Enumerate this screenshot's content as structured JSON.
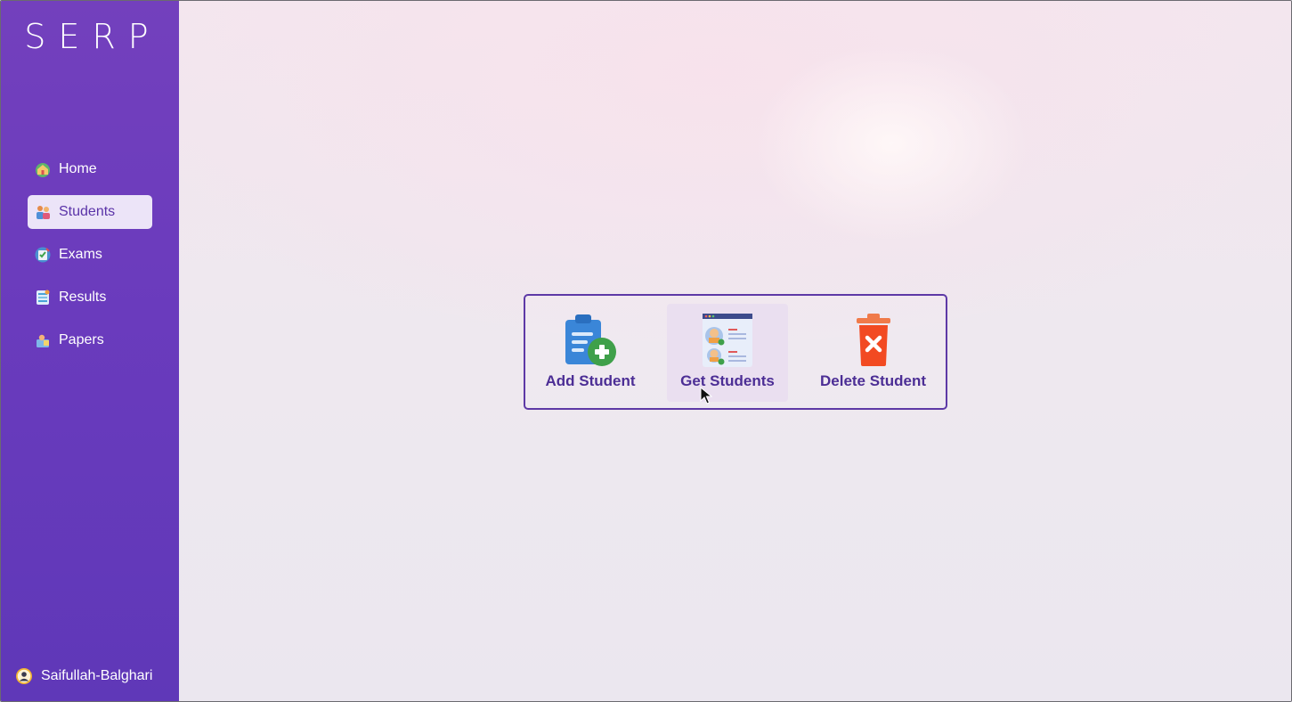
{
  "app": {
    "brand": "SERP"
  },
  "sidebar": {
    "items": [
      {
        "label": "Home",
        "icon": "home-icon",
        "active": false
      },
      {
        "label": "Students",
        "icon": "students-icon",
        "active": true
      },
      {
        "label": "Exams",
        "icon": "exams-icon",
        "active": false
      },
      {
        "label": "Results",
        "icon": "results-icon",
        "active": false
      },
      {
        "label": "Papers",
        "icon": "papers-icon",
        "active": false
      }
    ],
    "user": {
      "name": "Saifullah-Balghari",
      "icon": "user-avatar-icon"
    }
  },
  "main": {
    "actions": [
      {
        "label": "Add Student",
        "icon": "add-clipboard-icon"
      },
      {
        "label": "Get Students",
        "icon": "student-list-icon",
        "hovered": true
      },
      {
        "label": "Delete Student",
        "icon": "trash-delete-icon"
      }
    ]
  },
  "colors": {
    "sidebar": "#6a3bbd",
    "accent": "#5d39a6",
    "active_item_bg": "#ece4f8"
  }
}
